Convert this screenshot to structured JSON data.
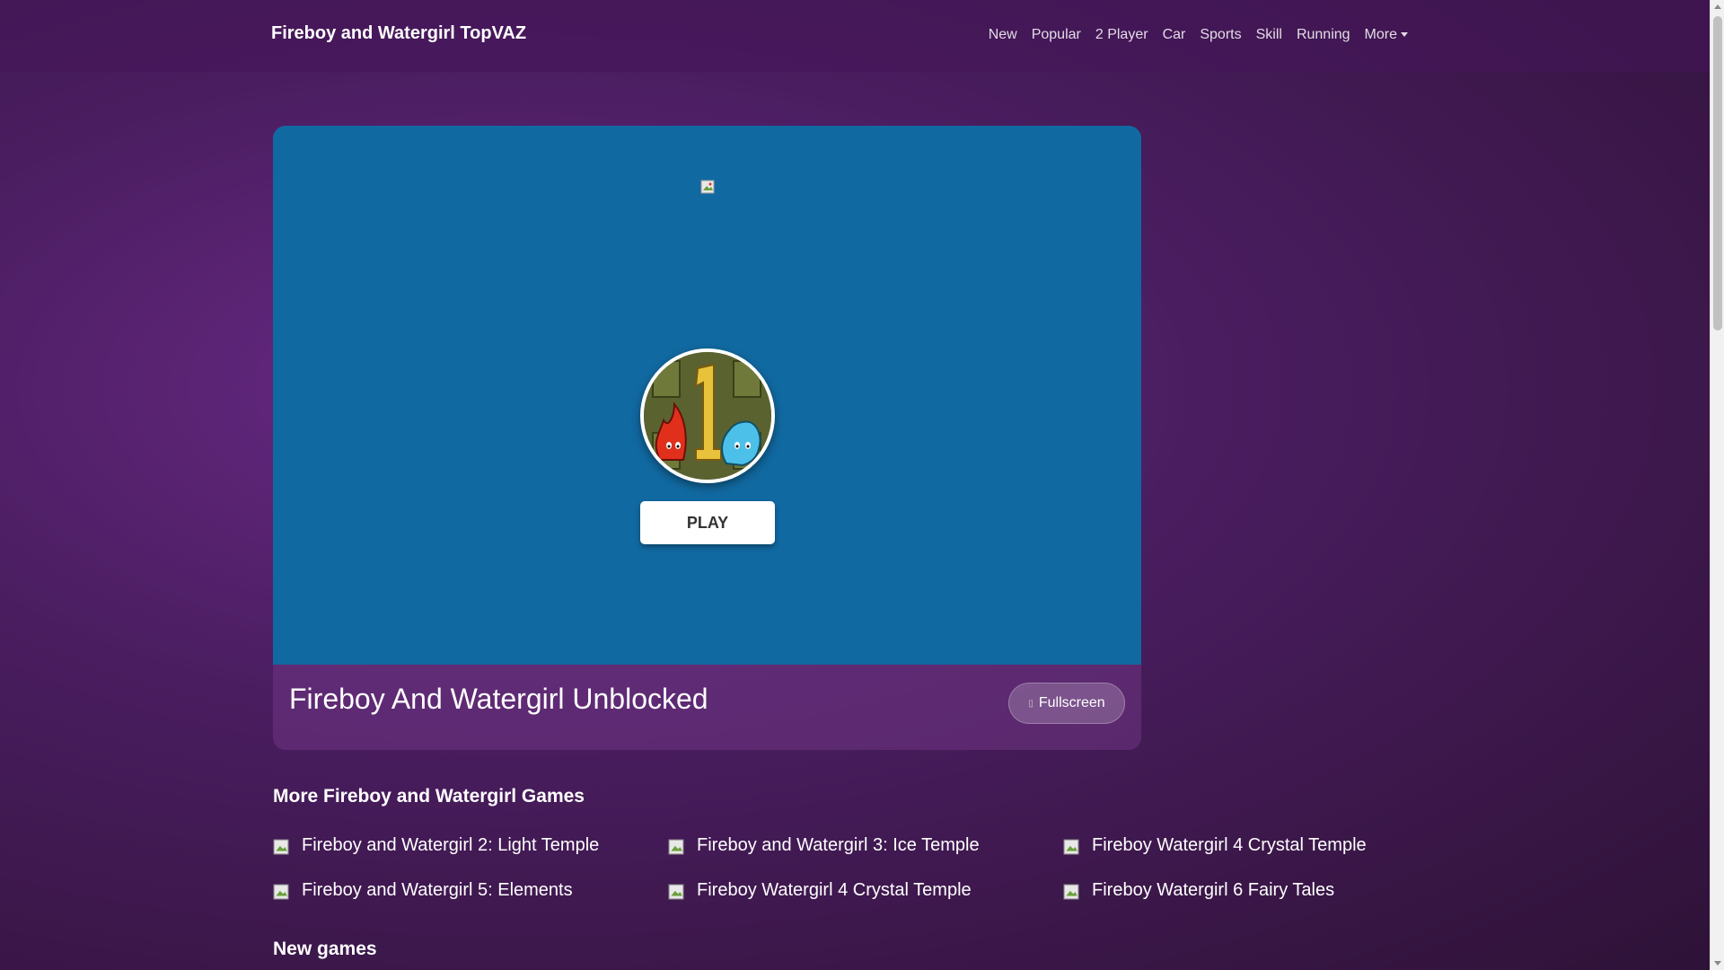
{
  "navbar": {
    "brand": "Fireboy and Watergirl TopVAZ",
    "links": [
      "New",
      "Popular",
      "2 Player",
      "Car",
      "Sports",
      "Skill",
      "Running"
    ],
    "more_label": "More"
  },
  "game": {
    "play_label": "PLAY",
    "title": "Fireboy And Watergirl Unblocked",
    "fullscreen_label": "Fullscreen",
    "frame_color": "#1169a1"
  },
  "more_games": {
    "heading": "More Fireboy and Watergirl Games",
    "items": [
      "Fireboy and Watergirl 2: Light Temple",
      "Fireboy and Watergirl 3: Ice Temple",
      "Fireboy Watergirl 4 Crystal Temple",
      "Fireboy and Watergirl 5: Elements",
      "Fireboy Watergirl 4 Crystal Temple",
      "Fireboy Watergirl 6 Fairy Tales"
    ]
  },
  "new_games": {
    "heading": "New games"
  }
}
